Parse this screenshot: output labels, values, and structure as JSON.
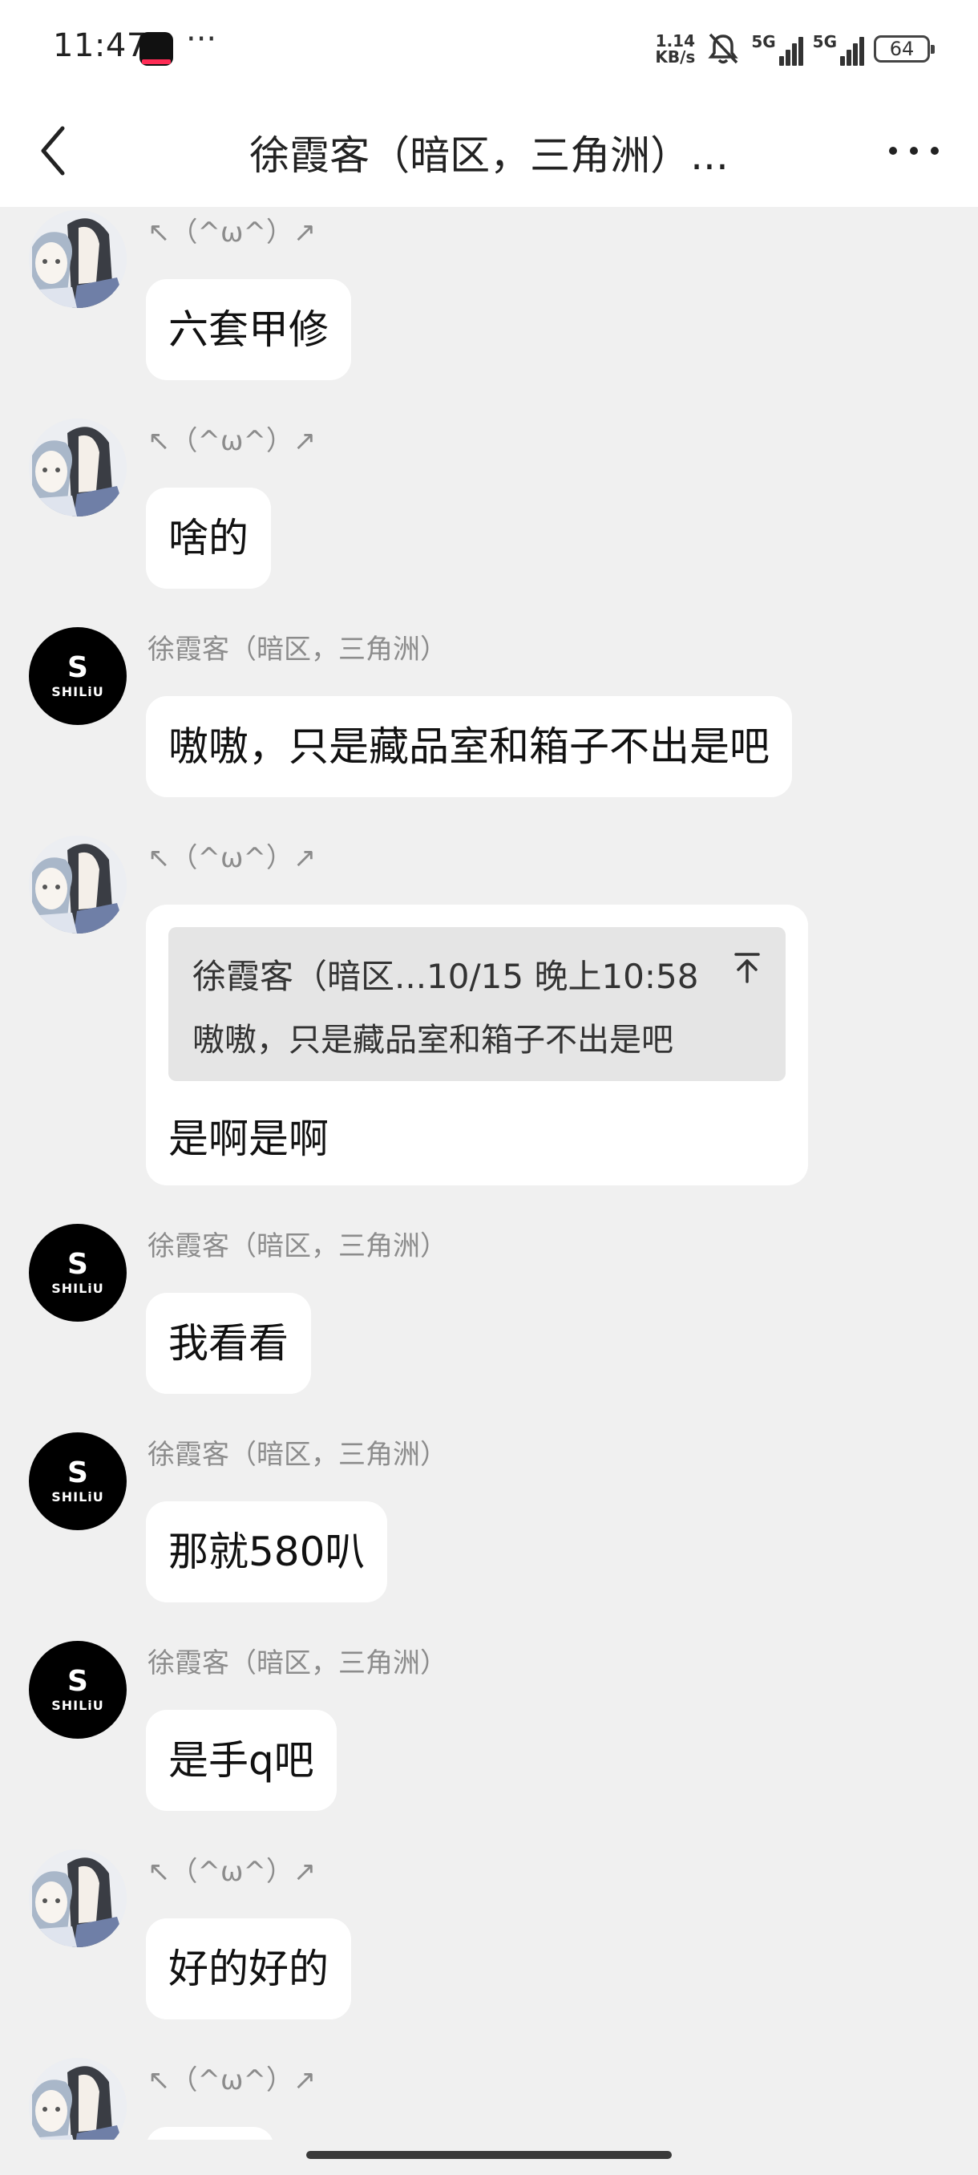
{
  "status_bar": {
    "time": "11:47",
    "more": "···",
    "net_speed_value": "1.14",
    "net_speed_unit": "KB/s",
    "signal_1": "5G",
    "signal_2": "5G",
    "battery": "64"
  },
  "header": {
    "title": "徐霞客（暗区，三角洲）...",
    "back_icon": "chevron-left-icon",
    "more_icon": "more-dots-icon"
  },
  "contacts": {
    "me_name": "↖（^ω^）↗",
    "other_name": "徐霞客（暗区，三角洲）",
    "other_avatar_mark": "S",
    "other_avatar_text": "SHILiU"
  },
  "messages": [
    {
      "sender": "me",
      "text": "六套甲修"
    },
    {
      "sender": "me",
      "text": "啥的"
    },
    {
      "sender": "other",
      "text": "嗷嗷，只是藏品室和箱子不出是吧"
    },
    {
      "sender": "me",
      "quote_header": "徐霞客（暗区...10/15 晚上10:58",
      "quote_text": "嗷嗷，只是藏品室和箱子不出是吧",
      "text": "是啊是啊"
    },
    {
      "sender": "other",
      "text": "我看看"
    },
    {
      "sender": "other",
      "text": "那就580叭"
    },
    {
      "sender": "other",
      "text": "是手q吧"
    },
    {
      "sender": "me",
      "text": "好的好的"
    },
    {
      "sender": "me",
      "text": ""
    }
  ]
}
